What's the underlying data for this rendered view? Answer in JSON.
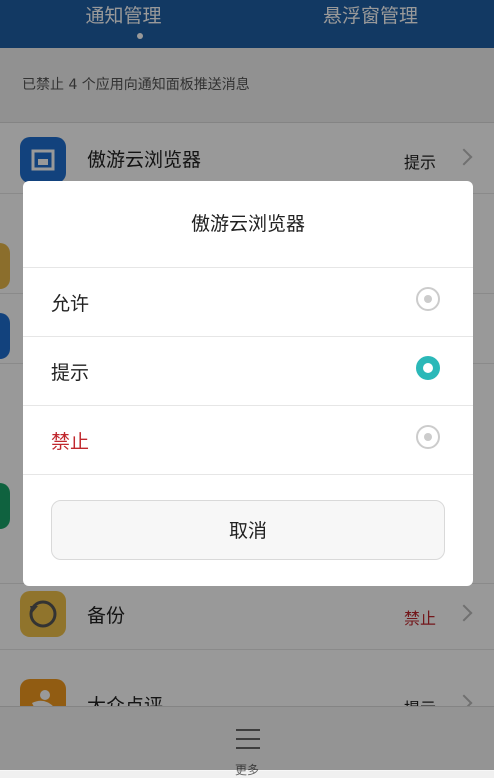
{
  "header": {
    "tabs": [
      {
        "label": "通知管理"
      },
      {
        "label": "悬浮窗管理"
      }
    ]
  },
  "notice": {
    "text": "已禁止 4 个应用向通知面板推送消息"
  },
  "list": {
    "rows": [
      {
        "name": "傲游云浏览器",
        "status": "提示"
      },
      {
        "name": "备份",
        "status": "禁止"
      },
      {
        "name": "大众点评",
        "status": "提示"
      }
    ]
  },
  "dialog": {
    "title": "傲游云浏览器",
    "options": [
      {
        "label": "允许",
        "selected": false
      },
      {
        "label": "提示",
        "selected": true
      },
      {
        "label": "禁止",
        "selected": false
      }
    ],
    "cancel_label": "取消"
  },
  "bottombar": {
    "label": "更多"
  },
  "colors": {
    "header_bg": "#1f5fa6",
    "accent": "#2bb8b8",
    "forbid_red": "#c0272d"
  }
}
